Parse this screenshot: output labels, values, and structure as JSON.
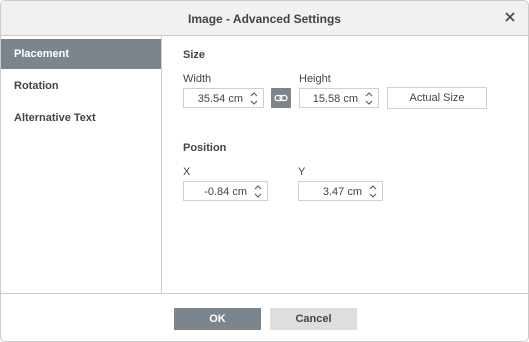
{
  "dialog": {
    "title": "Image - Advanced Settings"
  },
  "sidebar": {
    "items": [
      {
        "label": "Placement",
        "active": true
      },
      {
        "label": "Rotation",
        "active": false
      },
      {
        "label": "Alternative Text",
        "active": false
      }
    ]
  },
  "size": {
    "section_label": "Size",
    "width_label": "Width",
    "width_value": "35.54 cm",
    "height_label": "Height",
    "height_value": "15.58 cm",
    "actual_size_label": "Actual Size"
  },
  "position": {
    "section_label": "Position",
    "x_label": "X",
    "x_value": "-0.84 cm",
    "y_label": "Y",
    "y_value": "3.47 cm"
  },
  "footer": {
    "ok_label": "OK",
    "cancel_label": "Cancel"
  },
  "colors": {
    "accent": "#7d858c",
    "border": "#cbcbcb",
    "titlebar": "#f1f1f1"
  }
}
